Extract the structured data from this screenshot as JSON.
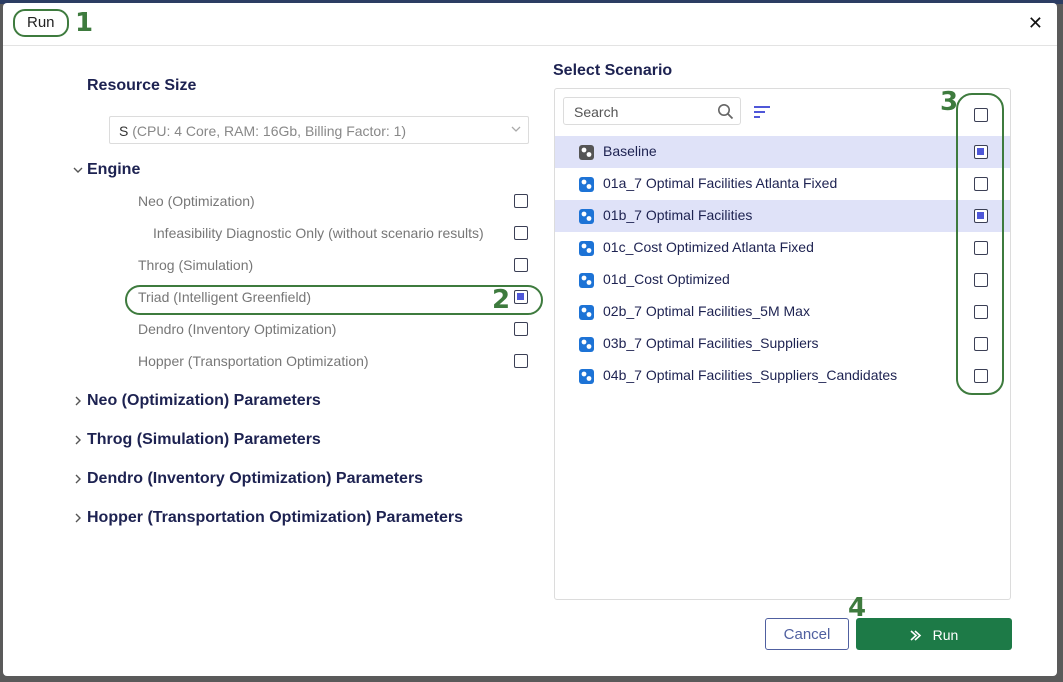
{
  "dialog": {
    "title": "Run",
    "close_glyph": "✕"
  },
  "annotations": [
    "1",
    "2",
    "3",
    "4"
  ],
  "resource": {
    "label": "Resource Size",
    "selected_size": "S",
    "selected_detail": "(CPU: 4 Core, RAM: 16Gb, Billing Factor: 1)"
  },
  "engine": {
    "label": "Engine",
    "items": [
      {
        "label": "Neo (Optimization)",
        "checked": false
      },
      {
        "label": "Infeasibility Diagnostic Only (without scenario results)",
        "checked": false
      },
      {
        "label": "Throg (Simulation)",
        "checked": false
      },
      {
        "label": "Triad (Intelligent Greenfield)",
        "checked": true
      },
      {
        "label": "Dendro (Inventory Optimization)",
        "checked": false
      },
      {
        "label": "Hopper (Transportation Optimization)",
        "checked": false
      }
    ]
  },
  "parameter_sections": [
    "Neo (Optimization) Parameters",
    "Throg (Simulation) Parameters",
    "Dendro (Inventory Optimization) Parameters",
    "Hopper (Transportation Optimization) Parameters"
  ],
  "scenarios": {
    "label": "Select Scenario",
    "search_placeholder": "Search",
    "select_all_checked": false,
    "items": [
      {
        "label": "Baseline",
        "checked": true,
        "icon": "baseline-scenario-icon"
      },
      {
        "label": "01a_7 Optimal Facilities Atlanta Fixed",
        "checked": false,
        "icon": "scenario-icon"
      },
      {
        "label": "01b_7 Optimal Facilities",
        "checked": true,
        "icon": "scenario-icon"
      },
      {
        "label": "01c_Cost Optimized Atlanta Fixed",
        "checked": false,
        "icon": "scenario-icon"
      },
      {
        "label": "01d_Cost Optimized",
        "checked": false,
        "icon": "scenario-icon"
      },
      {
        "label": "02b_7 Optimal Facilities_5M Max",
        "checked": false,
        "icon": "scenario-icon"
      },
      {
        "label": "03b_7 Optimal Facilities_Suppliers",
        "checked": false,
        "icon": "scenario-icon"
      },
      {
        "label": "04b_7 Optimal Facilities_Suppliers_Candidates",
        "checked": false,
        "icon": "scenario-icon"
      }
    ]
  },
  "buttons": {
    "cancel": "Cancel",
    "run": "Run"
  },
  "colors": {
    "accent_green": "#3e7b3e",
    "run_button": "#1d7a47",
    "navy_text": "#1d2251",
    "selection": "#dfe2f8",
    "check_fill": "#4f57d8",
    "scenario_icon": "#1d73d6",
    "baseline_icon": "#555555"
  }
}
